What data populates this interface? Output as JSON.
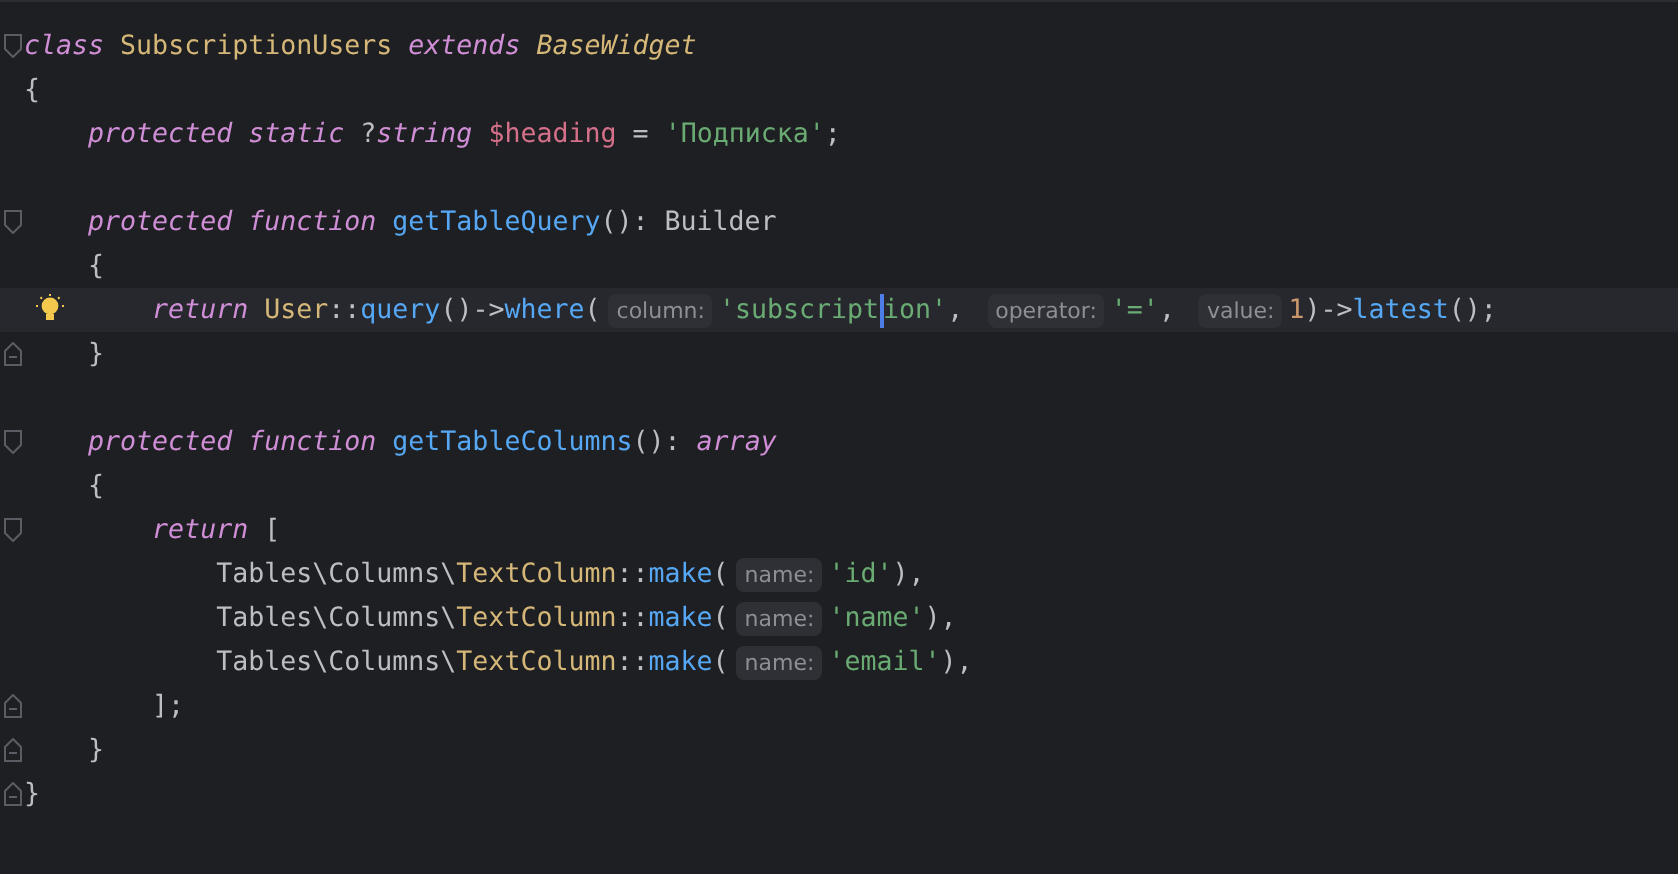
{
  "editor": {
    "lines": [
      {
        "current": false,
        "fold_start": true,
        "tokens": [
          {
            "kind": "keyword",
            "text": "class "
          },
          {
            "kind": "class",
            "text": "SubscriptionUsers "
          },
          {
            "kind": "keyword",
            "text": "extends "
          },
          {
            "kind": "class_italic",
            "text": "BaseWidget"
          }
        ]
      },
      {
        "current": false,
        "tokens": [
          {
            "kind": "plain",
            "text": "{"
          }
        ]
      },
      {
        "current": false,
        "tokens": [
          {
            "kind": "keyword",
            "text": "    protected static "
          },
          {
            "kind": "plain",
            "text": "?"
          },
          {
            "kind": "keyword",
            "text": "string "
          },
          {
            "kind": "variable",
            "text": "$heading"
          },
          {
            "kind": "plain",
            "text": " = "
          },
          {
            "kind": "string",
            "text": "'Подписка'"
          },
          {
            "kind": "plain",
            "text": ";"
          }
        ]
      },
      {
        "current": false
      },
      {
        "current": false,
        "fold_start": true,
        "tokens": [
          {
            "kind": "keyword",
            "text": "    protected function "
          },
          {
            "kind": "function",
            "text": "getTableQuery"
          },
          {
            "kind": "plain",
            "text": "(): Builder"
          }
        ]
      },
      {
        "current": false,
        "tokens": [
          {
            "kind": "plain",
            "text": "    {"
          }
        ]
      },
      {
        "current": true,
        "bulb": true,
        "tokens": [
          {
            "kind": "keyword",
            "text": "        return "
          },
          {
            "kind": "class",
            "text": "User"
          },
          {
            "kind": "plain",
            "text": "::"
          },
          {
            "kind": "function",
            "text": "query"
          },
          {
            "kind": "plain",
            "text": "()->"
          },
          {
            "kind": "function",
            "text": "where"
          },
          {
            "kind": "plain",
            "text": "("
          },
          {
            "kind": "hint",
            "text": "column:"
          },
          {
            "kind": "string",
            "text": "'subscript"
          },
          {
            "kind": "caret"
          },
          {
            "kind": "string",
            "text": "ion'"
          },
          {
            "kind": "plain",
            "text": ", "
          },
          {
            "kind": "hint",
            "text": "operator:"
          },
          {
            "kind": "string",
            "text": "'='"
          },
          {
            "kind": "plain",
            "text": ", "
          },
          {
            "kind": "hint",
            "text": "value:"
          },
          {
            "kind": "number",
            "text": "1"
          },
          {
            "kind": "plain",
            "text": ")->"
          },
          {
            "kind": "function",
            "text": "latest"
          },
          {
            "kind": "plain",
            "text": "();"
          }
        ]
      },
      {
        "current": false,
        "fold_end": true,
        "tokens": [
          {
            "kind": "plain",
            "text": "    }"
          }
        ]
      },
      {
        "current": false
      },
      {
        "current": false,
        "fold_start": true,
        "tokens": [
          {
            "kind": "keyword",
            "text": "    protected function "
          },
          {
            "kind": "function",
            "text": "getTableColumns"
          },
          {
            "kind": "plain",
            "text": "(): "
          },
          {
            "kind": "keyword",
            "text": "array"
          }
        ]
      },
      {
        "current": false,
        "tokens": [
          {
            "kind": "plain",
            "text": "    {"
          }
        ]
      },
      {
        "current": false,
        "fold_start": true,
        "tokens": [
          {
            "kind": "keyword",
            "text": "        return "
          },
          {
            "kind": "plain",
            "text": "["
          }
        ]
      },
      {
        "current": false,
        "tokens": [
          {
            "kind": "plain",
            "text": "            Tables\\Columns\\"
          },
          {
            "kind": "class",
            "text": "TextColumn"
          },
          {
            "kind": "plain",
            "text": "::"
          },
          {
            "kind": "function",
            "text": "make"
          },
          {
            "kind": "plain",
            "text": "("
          },
          {
            "kind": "hint",
            "text": "name:"
          },
          {
            "kind": "string",
            "text": "'id'"
          },
          {
            "kind": "plain",
            "text": "),"
          }
        ]
      },
      {
        "current": false,
        "tokens": [
          {
            "kind": "plain",
            "text": "            Tables\\Columns\\"
          },
          {
            "kind": "class",
            "text": "TextColumn"
          },
          {
            "kind": "plain",
            "text": "::"
          },
          {
            "kind": "function",
            "text": "make"
          },
          {
            "kind": "plain",
            "text": "("
          },
          {
            "kind": "hint",
            "text": "name:"
          },
          {
            "kind": "string",
            "text": "'name'"
          },
          {
            "kind": "plain",
            "text": "),"
          }
        ]
      },
      {
        "current": false,
        "tokens": [
          {
            "kind": "plain",
            "text": "            Tables\\Columns\\"
          },
          {
            "kind": "class",
            "text": "TextColumn"
          },
          {
            "kind": "plain",
            "text": "::"
          },
          {
            "kind": "function",
            "text": "make"
          },
          {
            "kind": "plain",
            "text": "("
          },
          {
            "kind": "hint",
            "text": "name:"
          },
          {
            "kind": "string",
            "text": "'email'"
          },
          {
            "kind": "plain",
            "text": "),"
          }
        ]
      },
      {
        "current": false,
        "fold_end": true,
        "tokens": [
          {
            "kind": "plain",
            "text": "        ];"
          }
        ]
      },
      {
        "current": false,
        "fold_end": true,
        "tokens": [
          {
            "kind": "plain",
            "text": "    }"
          }
        ]
      },
      {
        "current": false,
        "fold_end": true,
        "tokens": [
          {
            "kind": "plain",
            "text": "}"
          }
        ]
      }
    ]
  }
}
